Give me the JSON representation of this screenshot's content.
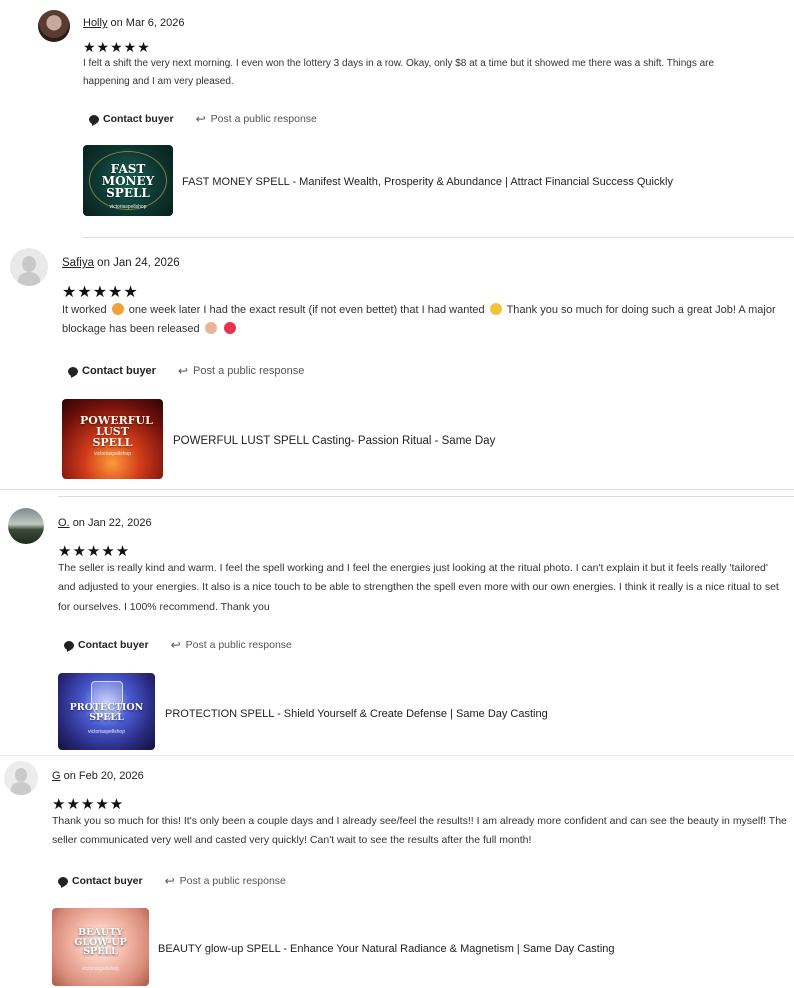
{
  "reviews": [
    {
      "name": "Holly",
      "date": "on Mar 6, 2026",
      "stars": "★★★★★",
      "text": "I felt a shift the very next morning. I even won the lottery 3 days in a row. Okay, only $8 at a time but it showed me there was a shift. Things are happening and I am very pleased.",
      "contact_label": "Contact buyer",
      "respond_label": "Post a public response",
      "product_title": "FAST MONEY SPELL - Manifest Wealth, Prosperity & Abundance | Attract Financial Success Quickly",
      "thumb_text": "FAST MONEY SPELL",
      "thumb_sub": "victoriaspellshop"
    },
    {
      "name": "Safiya",
      "date": "on Jan 24, 2026",
      "stars": "★★★★★",
      "text_parts": [
        "It worked",
        "one week later I had the exact result (if not even bettet) that I had wanted",
        "Thank you so much for doing such a great Job! A major blockage has been released"
      ],
      "contact_label": "Contact buyer",
      "respond_label": "Post a public response",
      "product_title": "POWERFUL LUST SPELL Casting- Passion Ritual - Same Day",
      "thumb_text": "POWERFUL LUST SPELL",
      "thumb_sub": "victoriaspellshop"
    },
    {
      "name": "O.",
      "date": "on Jan 22, 2026",
      "stars": "★★★★★",
      "text": "The seller is really kind and warm. I feel the spell working and I feel the energies just looking at the ritual photo. I can't explain it but it feels really 'tailored' and adjusted to your energies. It also is a nice touch to be able to strengthen the spell even more with our own energies. I think it really is a nice ritual to set for ourselves. I 100% recommend. Thank you",
      "contact_label": "Contact buyer",
      "respond_label": "Post a public response",
      "product_title": "PROTECTION SPELL - Shield Yourself & Create Defense | Same Day Casting",
      "thumb_text": "PROTECTION SPELL",
      "thumb_sub": "victoriaspellshop"
    },
    {
      "name": "G",
      "date": "on Feb 20, 2026",
      "stars": "★★★★★",
      "text": "Thank you so much for this! It's only been a couple days and I already see/feel the results!! I am already more confident and can see the beauty in myself! The seller communicated very well and casted very quickly! Can't wait to see the results after the full month!",
      "contact_label": "Contact buyer",
      "respond_label": "Post a public response",
      "product_title": "BEAUTY glow-up SPELL - Enhance Your Natural Radiance & Magnetism | Same Day Casting",
      "thumb_text": "BEAUTY GLOW-UP SPELL",
      "thumb_sub": "victoriaspellshop"
    }
  ],
  "icons": {
    "contact": "chat-bubble-icon",
    "respond": "reply-arrow-icon",
    "safiya_emojis": [
      "heart-face-emoji",
      "sunglasses-emoji",
      "praying-hands-emoji",
      "heart-emoji"
    ]
  },
  "colors": {
    "divider": "#dcdcdc",
    "text": "#333333",
    "link": "#222222"
  }
}
